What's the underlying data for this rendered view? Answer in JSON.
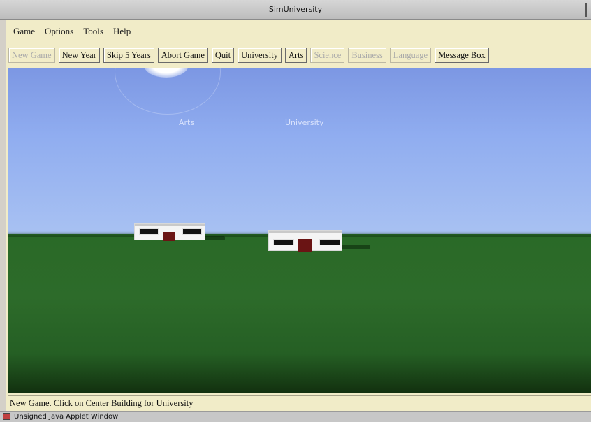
{
  "window": {
    "title": "SimUniversity"
  },
  "menu": {
    "items": [
      "Game",
      "Options",
      "Tools",
      "Help"
    ]
  },
  "toolbar": {
    "buttons": [
      {
        "label": "New Game",
        "enabled": false
      },
      {
        "label": "New Year",
        "enabled": true
      },
      {
        "label": "Skip 5 Years",
        "enabled": true
      },
      {
        "label": "Abort Game",
        "enabled": true
      },
      {
        "label": "Quit",
        "enabled": true
      },
      {
        "label": "University",
        "enabled": true
      },
      {
        "label": "Arts",
        "enabled": true
      },
      {
        "label": "Science",
        "enabled": false
      },
      {
        "label": "Business",
        "enabled": false
      },
      {
        "label": "Language",
        "enabled": false
      },
      {
        "label": "Message Box",
        "enabled": true
      }
    ]
  },
  "scene": {
    "labels": {
      "arts": "Arts",
      "university": "University"
    },
    "colors": {
      "sky": "#8aa6ec",
      "ground": "#2b6a28",
      "door": "#6a1414"
    }
  },
  "status": {
    "message": "New Game. Click on Center Building for University"
  },
  "applet_bar": {
    "text": "Unsigned Java Applet Window",
    "icon": "java-cup-icon"
  }
}
